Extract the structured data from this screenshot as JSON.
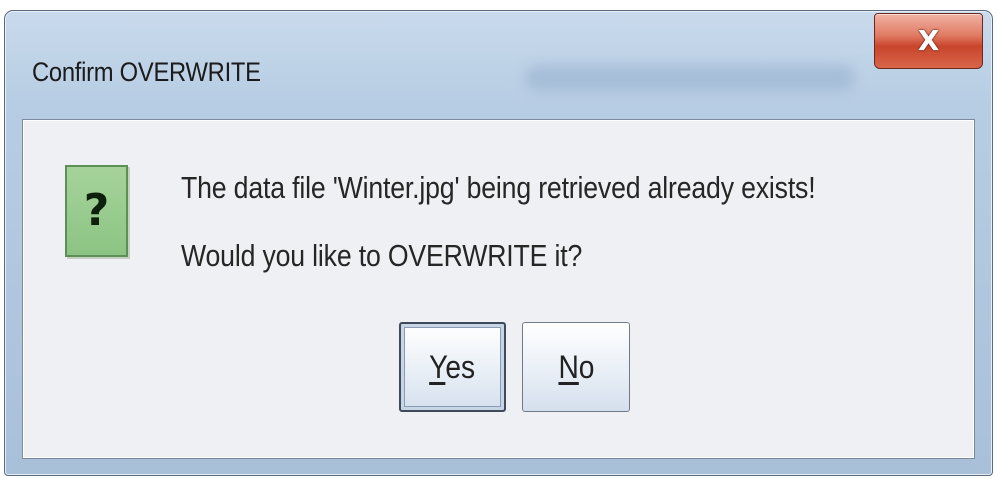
{
  "window": {
    "title": "Confirm OVERWRITE",
    "close_glyph": "X"
  },
  "dialog": {
    "icon": {
      "name": "question-icon",
      "glyph": "?"
    },
    "message_line1": "The data file 'Winter.jpg' being retrieved already exists!",
    "message_line2": "Would you like to OVERWRITE it?"
  },
  "buttons": {
    "yes": {
      "mnemonic": "Y",
      "rest": "es",
      "default": true
    },
    "no": {
      "mnemonic": "N",
      "rest": "o",
      "default": false
    }
  },
  "colors": {
    "titlebar": "#b7cde3",
    "close_button": "#c8452b",
    "client_background": "#eef0f3",
    "question_icon": "#8cc483"
  }
}
